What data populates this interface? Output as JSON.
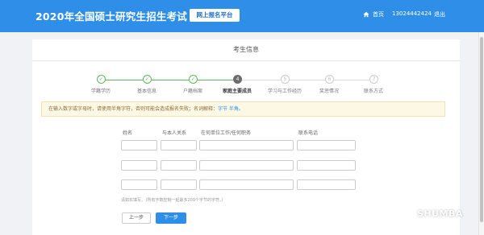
{
  "header": {
    "title": "2020年全国硕士研究生招生考试",
    "badge": "网上报名平台",
    "home_label": "首页",
    "phone": "13024442424",
    "logout_label": "退出"
  },
  "card": {
    "title": "考生信息"
  },
  "steps": [
    {
      "label": "学籍学历",
      "state": "done",
      "marker": "✓"
    },
    {
      "label": "基本信息",
      "state": "done",
      "marker": "✓"
    },
    {
      "label": "户籍档案",
      "state": "done",
      "marker": "✓"
    },
    {
      "label": "家庭主要成员",
      "state": "active",
      "marker": "4"
    },
    {
      "label": "学习与工作经历",
      "state": "todo",
      "marker": "5"
    },
    {
      "label": "奖惩情况",
      "state": "todo",
      "marker": "6"
    },
    {
      "label": "联系方式",
      "state": "todo",
      "marker": "7"
    }
  ],
  "notice": {
    "text": "在输入数字或字母时，请使用半角字符，否则可能会造成报名失败；名词解释：",
    "example_link": "字节 半角。"
  },
  "form": {
    "columns": [
      "姓名",
      "与本人关系",
      "在何单位工作/任何职务",
      "联系电话"
    ],
    "rows": [
      [
        "",
        "",
        "",
        ""
      ],
      [
        "",
        "",
        "",
        ""
      ],
      [
        "",
        "",
        "",
        ""
      ]
    ],
    "footnote": "请如实填写。（所有字数控制一起最多200个字节的字符。）"
  },
  "buttons": {
    "prev": "上一步",
    "next": "下一步"
  },
  "watermark": {
    "text": "SHUMBA"
  },
  "colors": {
    "header_blue": "#2f8fe8",
    "done_green": "#5cb85c",
    "notice_bg": "#fcf8e3"
  }
}
